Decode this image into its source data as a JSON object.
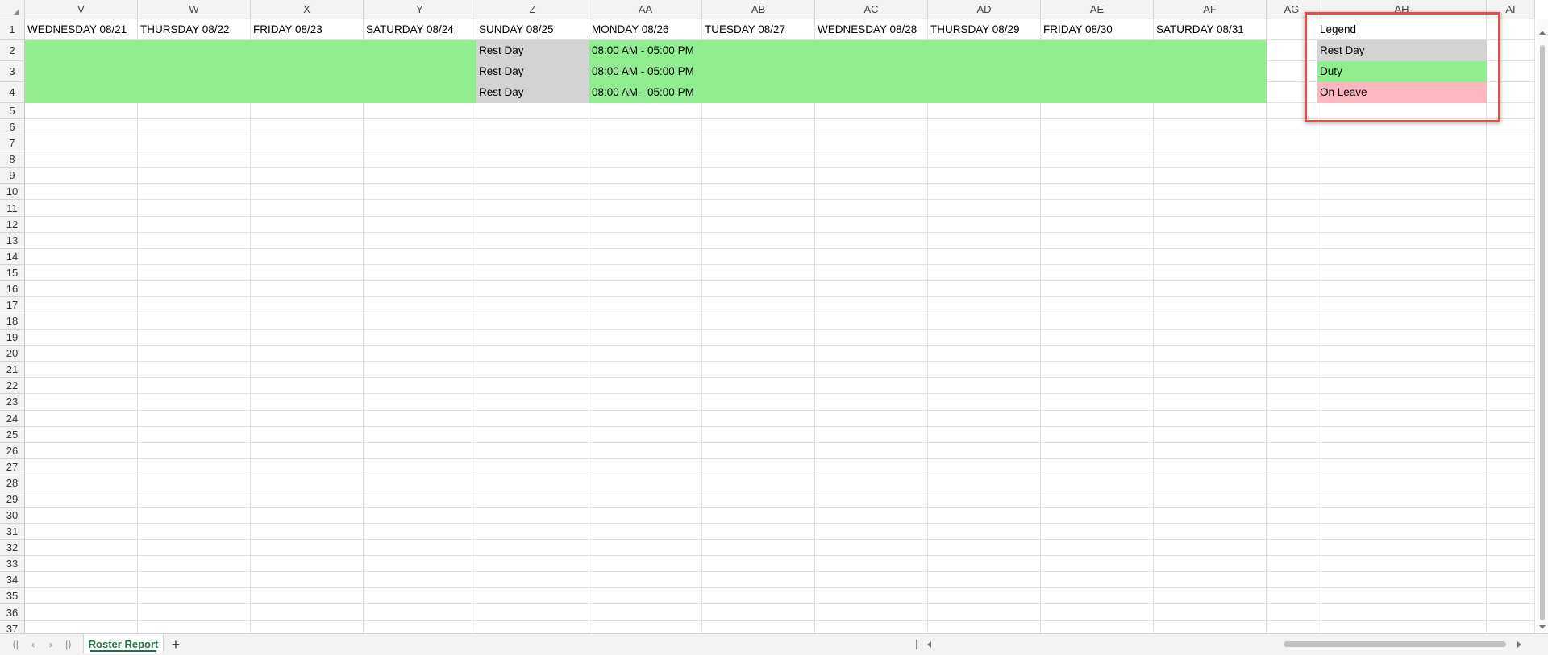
{
  "sheet": {
    "columns": [
      "V",
      "W",
      "X",
      "Y",
      "Z",
      "AA",
      "AB",
      "AC",
      "AD",
      "AE",
      "AF",
      "AG",
      "AH",
      "AI"
    ],
    "row_numbers": [
      "1",
      "2",
      "3",
      "4",
      "5",
      "6",
      "7",
      "8",
      "9",
      "10",
      "11",
      "12",
      "13",
      "14",
      "15",
      "16",
      "17",
      "18",
      "19",
      "20",
      "21",
      "22",
      "23",
      "24",
      "25",
      "26",
      "27",
      "28",
      "29",
      "30",
      "31",
      "32",
      "33",
      "34",
      "35",
      "36",
      "37"
    ],
    "header_row": [
      "WEDNESDAY 08/21",
      "THURSDAY 08/22",
      "FRIDAY 08/23",
      "SATURDAY 08/24",
      "SUNDAY 08/25",
      "MONDAY 08/26",
      "TUESDAY 08/27",
      "WEDNESDAY 08/28",
      "THURSDAY 08/29",
      "FRIDAY 08/30",
      "SATURDAY 08/31",
      "",
      "Legend",
      ""
    ],
    "schedule_rows": [
      [
        "",
        "",
        "",
        "",
        "Rest Day",
        "08:00 AM - 05:00 PM",
        "",
        "",
        "",
        "",
        ""
      ],
      [
        "",
        "",
        "",
        "",
        "Rest Day",
        "08:00 AM - 05:00 PM",
        "",
        "",
        "",
        "",
        ""
      ],
      [
        "",
        "",
        "",
        "",
        "Rest Day",
        "08:00 AM - 05:00 PM",
        "",
        "",
        "",
        "",
        ""
      ]
    ],
    "schedule_status": [
      [
        "duty",
        "duty",
        "duty",
        "duty",
        "rest",
        "duty",
        "duty",
        "duty",
        "duty",
        "duty",
        "duty"
      ],
      [
        "duty",
        "duty",
        "duty",
        "duty",
        "rest",
        "duty",
        "duty",
        "duty",
        "duty",
        "duty",
        "duty"
      ],
      [
        "duty",
        "duty",
        "duty",
        "duty",
        "rest",
        "duty",
        "duty",
        "duty",
        "duty",
        "duty",
        "duty"
      ]
    ],
    "legend": {
      "title": "Legend",
      "items": [
        {
          "label": "Rest Day",
          "status": "rest"
        },
        {
          "label": "Duty",
          "status": "duty"
        },
        {
          "label": "On Leave",
          "status": "leave"
        }
      ]
    }
  },
  "colors": {
    "duty": "#90EE90",
    "rest": "#D3D3D3",
    "leave": "#FFB6C1",
    "legend_highlight": "#E0504A",
    "sheet_tab_text": "#217346"
  },
  "footer": {
    "active_sheet": "Roster Report",
    "add_sheet_label": "+",
    "nav_first": "⟨|",
    "nav_prev": "‹",
    "nav_next": "›",
    "nav_last": "|⟩"
  }
}
